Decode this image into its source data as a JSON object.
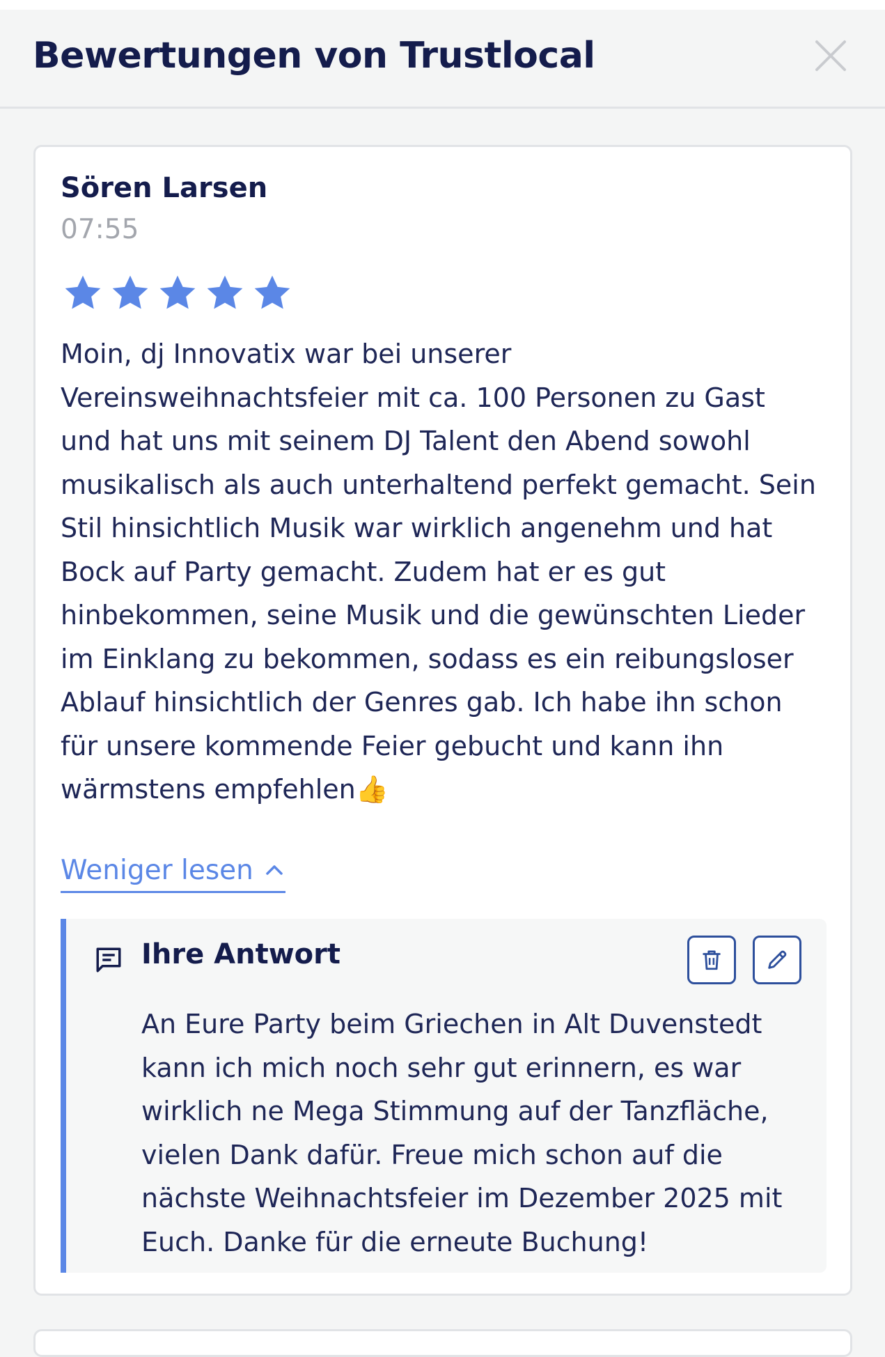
{
  "header": {
    "title": "Bewertungen von Trustlocal",
    "close_icon": "close-icon"
  },
  "review": {
    "author": "Sören Larsen",
    "time": "07:55",
    "rating": 5,
    "rating_max": 5,
    "star_color": "#5b87e6",
    "text_lines": [
      "Moin, dj Innovatix war bei unserer",
      "Vereinsweihnachtsfeier mit ca. 100 Personen zu Gast",
      "und hat uns mit seinem DJ Talent den Abend sowohl",
      "musikalisch als auch unterhaltend perfekt gemacht. Sein",
      "Stil hinsichtlich Musik war wirklich angenehm und hat",
      "Bock auf Party gemacht. Zudem hat er es gut",
      "hinbekommen, seine Musik und die gewünschten Lieder",
      "im Einklang zu bekommen, sodass es ein reibungsloser",
      "Ablauf hinsichtlich der Genres gab. Ich habe ihn schon",
      "für unsere kommende Feier gebucht und kann ihn",
      "wärmstens empfehlen"
    ],
    "emoji": "👍",
    "read_less_label": "Weniger lesen",
    "read_less_icon": "chevron-up-icon"
  },
  "reply": {
    "title": "Ihre Antwort",
    "icon": "comment-icon",
    "delete_icon": "trash-icon",
    "edit_icon": "pencil-icon",
    "accent_color": "#5b87e6",
    "text_lines": [
      "An Eure Party beim Griechen in Alt Duvenstedt",
      "kann ich mich noch sehr gut erinnern, es war",
      "wirklich ne Mega Stimmung auf der Tanzfläche,",
      "vielen Dank dafür. Freue mich schon auf die",
      "nächste Weihnachtsfeier im Dezember 2025 mit",
      "Euch. Danke für die erneute Buchung!"
    ]
  }
}
